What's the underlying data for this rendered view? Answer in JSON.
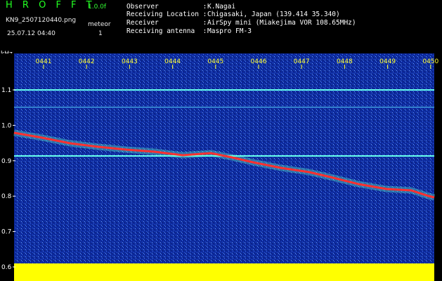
{
  "header": {
    "brand": "H R O F F T",
    "version": "1.0.0f",
    "filename": "KN9_2507120440.png",
    "mode_label": "meteor",
    "datetime": "25.07.12 04:40",
    "mode_value": "1"
  },
  "info": {
    "observer_key": "Observer           :",
    "observer_val": "K.Nagai",
    "location_key": "Receiving Location :",
    "location_val": "Chigasaki, Japan (139.414 35.340)",
    "receiver_key": "Receiver           :",
    "receiver_val": "AirSpy mini (Miakejima VOR 108.65MHz)",
    "antenna_key": "Receiving antenna  :",
    "antenna_val": "Maspro FM-3"
  },
  "spectrogram": {
    "y_unit": "kHz",
    "time_ticks": [
      "0441",
      "0442",
      "0443",
      "0444",
      "0445",
      "0446",
      "0447",
      "0448",
      "0449",
      "0450"
    ],
    "freq_ticks": [
      "1.1",
      "1.0",
      "0.9",
      "0.8",
      "0.7",
      "0.6"
    ],
    "freq_range": [
      0.6,
      1.15
    ],
    "colors": {
      "background": "#0a1f8c",
      "signal": "#ff3030",
      "level_bar": "#ffff00",
      "tick": "#ffff33"
    }
  }
}
